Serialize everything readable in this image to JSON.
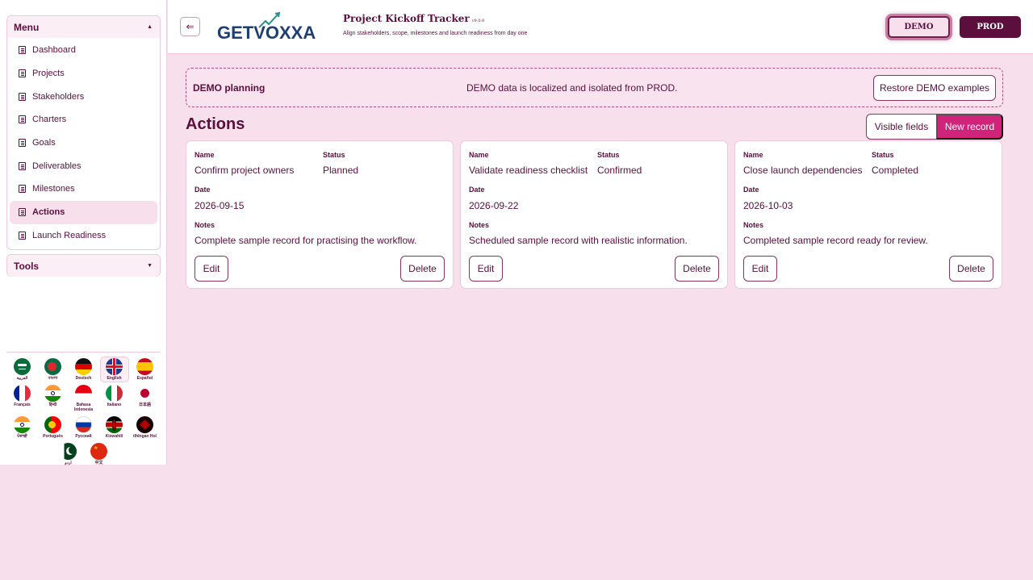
{
  "app": {
    "brand": "GETVOXXA",
    "title": "Project Kickoff Tracker",
    "version": "v9.0.0",
    "subtitle": "Align stakeholders, scope, milestones and launch readiness from day one"
  },
  "env": {
    "demo_label": "DEMO",
    "prod_label": "PROD",
    "active": "DEMO"
  },
  "sidebar": {
    "menu_title": "Menu",
    "tools_title": "Tools",
    "items": [
      {
        "label": "Dashboard"
      },
      {
        "label": "Projects"
      },
      {
        "label": "Stakeholders"
      },
      {
        "label": "Charters"
      },
      {
        "label": "Goals"
      },
      {
        "label": "Deliverables"
      },
      {
        "label": "Milestones"
      },
      {
        "label": "Actions",
        "active": true
      },
      {
        "label": "Launch Readiness"
      }
    ]
  },
  "languages": [
    {
      "label": "العربية"
    },
    {
      "label": "বাংলা"
    },
    {
      "label": "Deutsch"
    },
    {
      "label": "English",
      "active": true
    },
    {
      "label": "Español"
    },
    {
      "label": "Français"
    },
    {
      "label": "हिन्दी"
    },
    {
      "label": "Bahasa Indonesia"
    },
    {
      "label": "Italiano"
    },
    {
      "label": "日本語"
    },
    {
      "label": "ਪੰਜਾਬੀ"
    },
    {
      "label": "Português"
    },
    {
      "label": "Русский"
    },
    {
      "label": "Kiswahili"
    },
    {
      "label": "tlhIngan Hol"
    },
    {
      "label": "اردو"
    },
    {
      "label": "中文"
    }
  ],
  "banner": {
    "title": "DEMO planning",
    "message": "DEMO data is localized and isolated from PROD.",
    "restore_label": "Restore DEMO examples"
  },
  "actions": {
    "title": "Actions",
    "visible_fields_label": "Visible fields",
    "new_record_label": "New record",
    "field_labels": {
      "name": "Name",
      "status": "Status",
      "date": "Date",
      "notes": "Notes"
    },
    "edit_label": "Edit",
    "delete_label": "Delete",
    "records": [
      {
        "name": "Confirm project owners",
        "status": "Planned",
        "date": "2026-09-15",
        "notes": "Complete sample record for practising the workflow."
      },
      {
        "name": "Validate readiness checklist",
        "status": "Confirmed",
        "date": "2026-09-22",
        "notes": "Scheduled sample record with realistic information."
      },
      {
        "name": "Close launch dependencies",
        "status": "Completed",
        "date": "2026-10-03",
        "notes": "Completed sample record ready for review."
      }
    ]
  },
  "colors": {
    "brand": "#5c0f3c",
    "accent": "#d0237a",
    "background": "#f8dfec"
  }
}
